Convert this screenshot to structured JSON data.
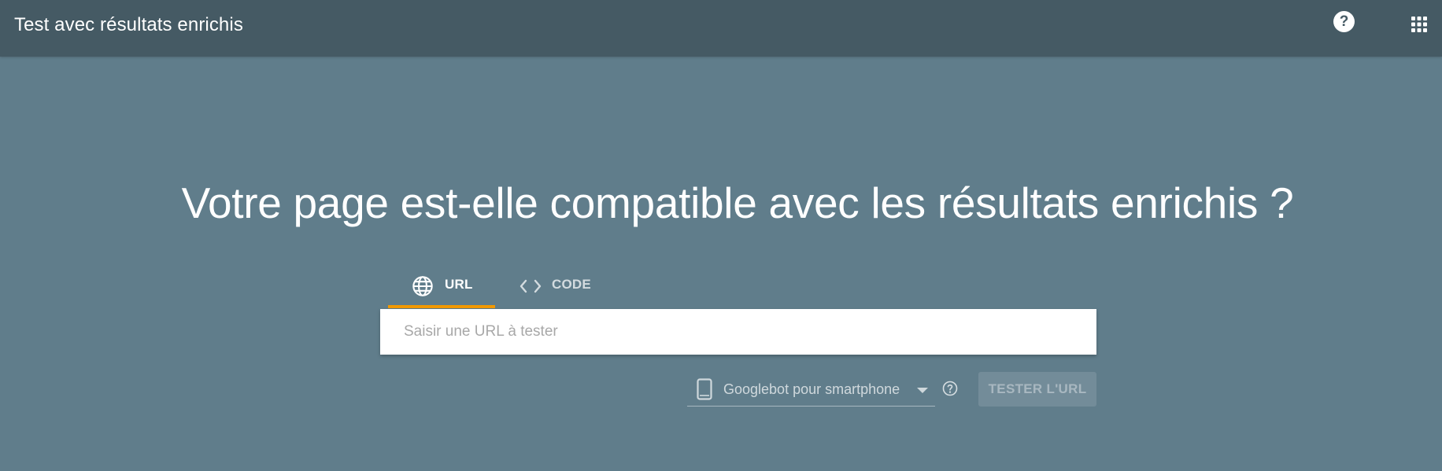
{
  "header": {
    "title": "Test avec résultats enrichis",
    "help_icon_glyph": "?",
    "help_icon": "help-circle-icon",
    "apps_icon": "apps-grid-icon"
  },
  "main": {
    "headline": "Votre page est-elle compatible avec les résultats enrichis ?",
    "tabs": [
      {
        "label": "URL",
        "icon": "globe-icon",
        "selected": true
      },
      {
        "label": "CODE",
        "icon": "code-icon",
        "selected": false
      }
    ],
    "url_input": {
      "placeholder": "Saisir une URL à tester",
      "value": ""
    },
    "user_agent": {
      "selected": "Googlebot pour smartphone",
      "icon": "smartphone-icon"
    },
    "test_button": {
      "label": "TESTER L'URL",
      "enabled": false
    }
  },
  "colors": {
    "header_bg": "#455a64",
    "page_bg": "#607d8b",
    "tab_indicator": "#f29900"
  }
}
